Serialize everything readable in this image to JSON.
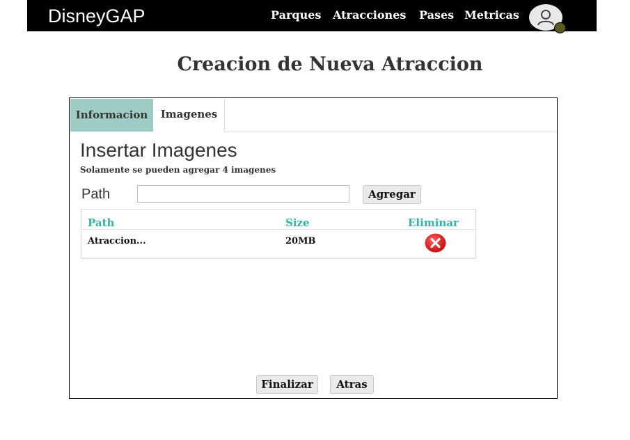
{
  "app": {
    "brand": "DisneyGAP"
  },
  "nav": {
    "items": [
      {
        "label": "Parques"
      },
      {
        "label": "Atracciones"
      },
      {
        "label": "Pases"
      },
      {
        "label": "Metricas"
      }
    ]
  },
  "page": {
    "title": "Creacion de Nueva Atraccion"
  },
  "tabs": [
    {
      "label": "Informacion",
      "active": true
    },
    {
      "label": "Imagenes",
      "active": false
    }
  ],
  "section": {
    "title": "Insertar Imagenes",
    "subtitle": "Solamente se pueden agregar 4 imagenes",
    "path_label": "Path",
    "path_value": "",
    "add_label": "Agregar"
  },
  "table": {
    "headers": [
      "Path",
      "Size",
      "Eliminar"
    ],
    "rows": [
      {
        "path": "Atraccion...",
        "size": "20MB"
      }
    ]
  },
  "footer": {
    "finish_label": "Finalizar",
    "back_label": "Atras"
  },
  "colors": {
    "accent": "#33b3a6",
    "tab_active": "#9ecbc3",
    "delete": "#e02424",
    "avatar_status": "#5b5a1c"
  },
  "icons": {
    "avatar": "user-icon",
    "delete": "close-circle-icon"
  }
}
